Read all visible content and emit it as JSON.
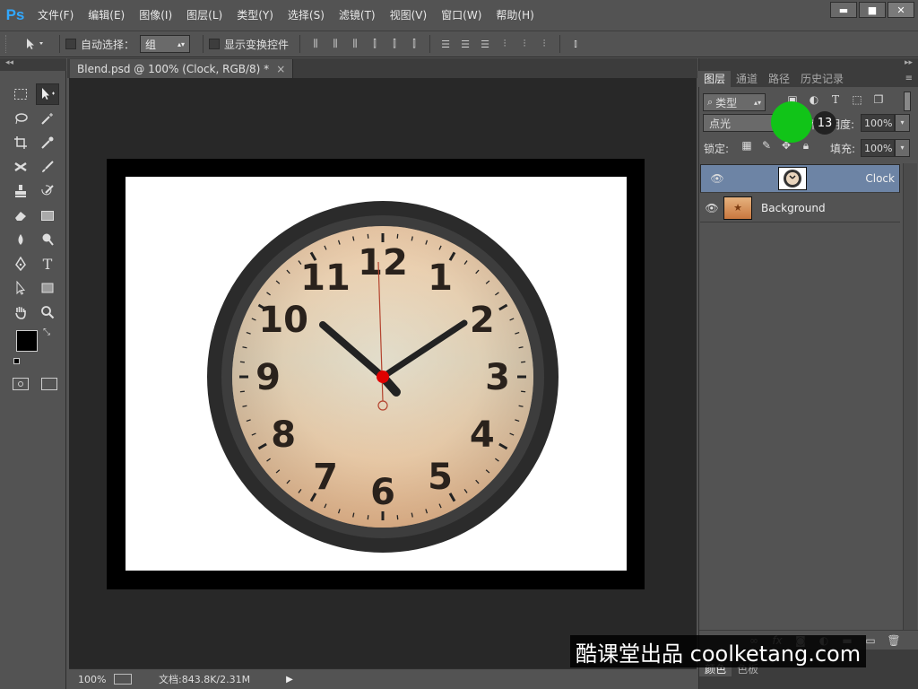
{
  "app": {
    "logo": "Ps"
  },
  "menu": [
    "文件(F)",
    "编辑(E)",
    "图像(I)",
    "图层(L)",
    "类型(Y)",
    "选择(S)",
    "滤镜(T)",
    "视图(V)",
    "窗口(W)",
    "帮助(H)"
  ],
  "window_controls": {
    "minimize": "▬",
    "restore": "■",
    "close": "✕"
  },
  "options": {
    "auto_select_label": "自动选择：",
    "auto_select_value": "组",
    "show_transform_label": "显示变换控件"
  },
  "document": {
    "tab_title": "Blend.psd @ 100% (Clock, RGB/8) *",
    "close_glyph": "×",
    "zoom": "100%",
    "doc_size": "文档:843.8K/2.31M"
  },
  "clock": {
    "numerals": [
      "12",
      "1",
      "2",
      "3",
      "4",
      "5",
      "6",
      "7",
      "8",
      "9",
      "10",
      "11"
    ]
  },
  "panel": {
    "tabs": [
      "图层",
      "通道",
      "路径",
      "历史记录"
    ],
    "filter_kind": "类型",
    "blend_mode": "点光",
    "opacity_label": "不透明度:",
    "opacity_value": "100%",
    "lock_label": "锁定:",
    "fill_label": "填充:",
    "fill_value": "100%",
    "cursor_badge": "13",
    "bottom_tabs": [
      "颜色",
      "色板"
    ]
  },
  "layers": [
    {
      "name": "Clock",
      "selected": true
    },
    {
      "name": "Background",
      "selected": false
    }
  ],
  "watermark": "酷课堂出品 coolketang.com"
}
